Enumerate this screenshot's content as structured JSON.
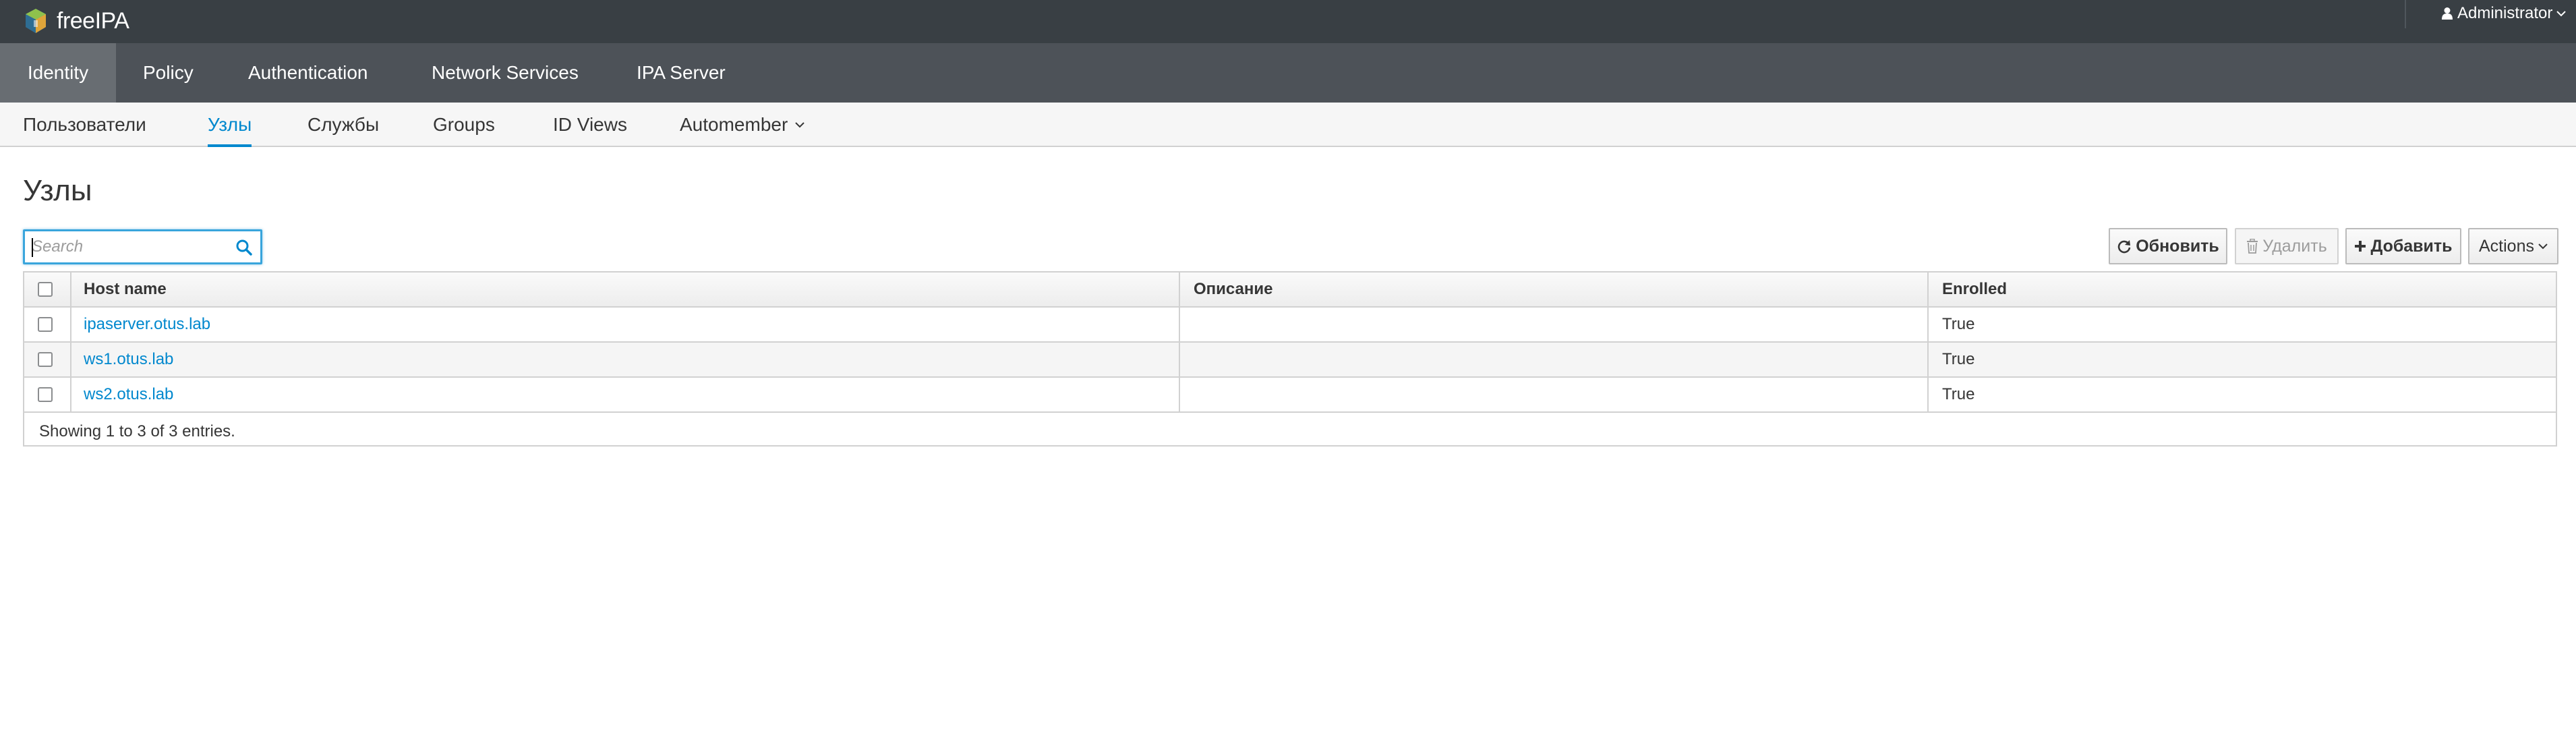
{
  "brand": {
    "name": "freeIPA",
    "logo_icon": "freeipa-logo-icon"
  },
  "user_menu": {
    "label": "Administrator",
    "icon": "user-icon"
  },
  "primary_nav": [
    {
      "label": "Identity",
      "active": true
    },
    {
      "label": "Policy"
    },
    {
      "label": "Authentication"
    },
    {
      "label": "Network Services"
    },
    {
      "label": "IPA Server"
    }
  ],
  "secondary_nav": [
    {
      "label": "Пользователи"
    },
    {
      "label": "Узлы",
      "active": true
    },
    {
      "label": "Службы"
    },
    {
      "label": "Groups"
    },
    {
      "label": "ID Views"
    },
    {
      "label": "Automember",
      "has_dropdown": true
    }
  ],
  "page": {
    "title": "Узлы"
  },
  "search": {
    "placeholder": "Search",
    "value": ""
  },
  "toolbar": {
    "refresh_label": "Обновить",
    "delete_label": "Удалить",
    "add_label": "Добавить",
    "actions_label": "Actions"
  },
  "table": {
    "columns": [
      "Host name",
      "Описание",
      "Enrolled"
    ],
    "rows": [
      {
        "host": "ipaserver.otus.lab",
        "description": "",
        "enrolled": "True"
      },
      {
        "host": "ws1.otus.lab",
        "description": "",
        "enrolled": "True"
      },
      {
        "host": "ws2.otus.lab",
        "description": "",
        "enrolled": "True"
      }
    ],
    "footer": "Showing 1 to 3 of 3 entries."
  },
  "colors": {
    "topbar": "#393f44",
    "navbar": "#4d5258",
    "nav_active": "#686d72",
    "accent": "#0088ce"
  }
}
